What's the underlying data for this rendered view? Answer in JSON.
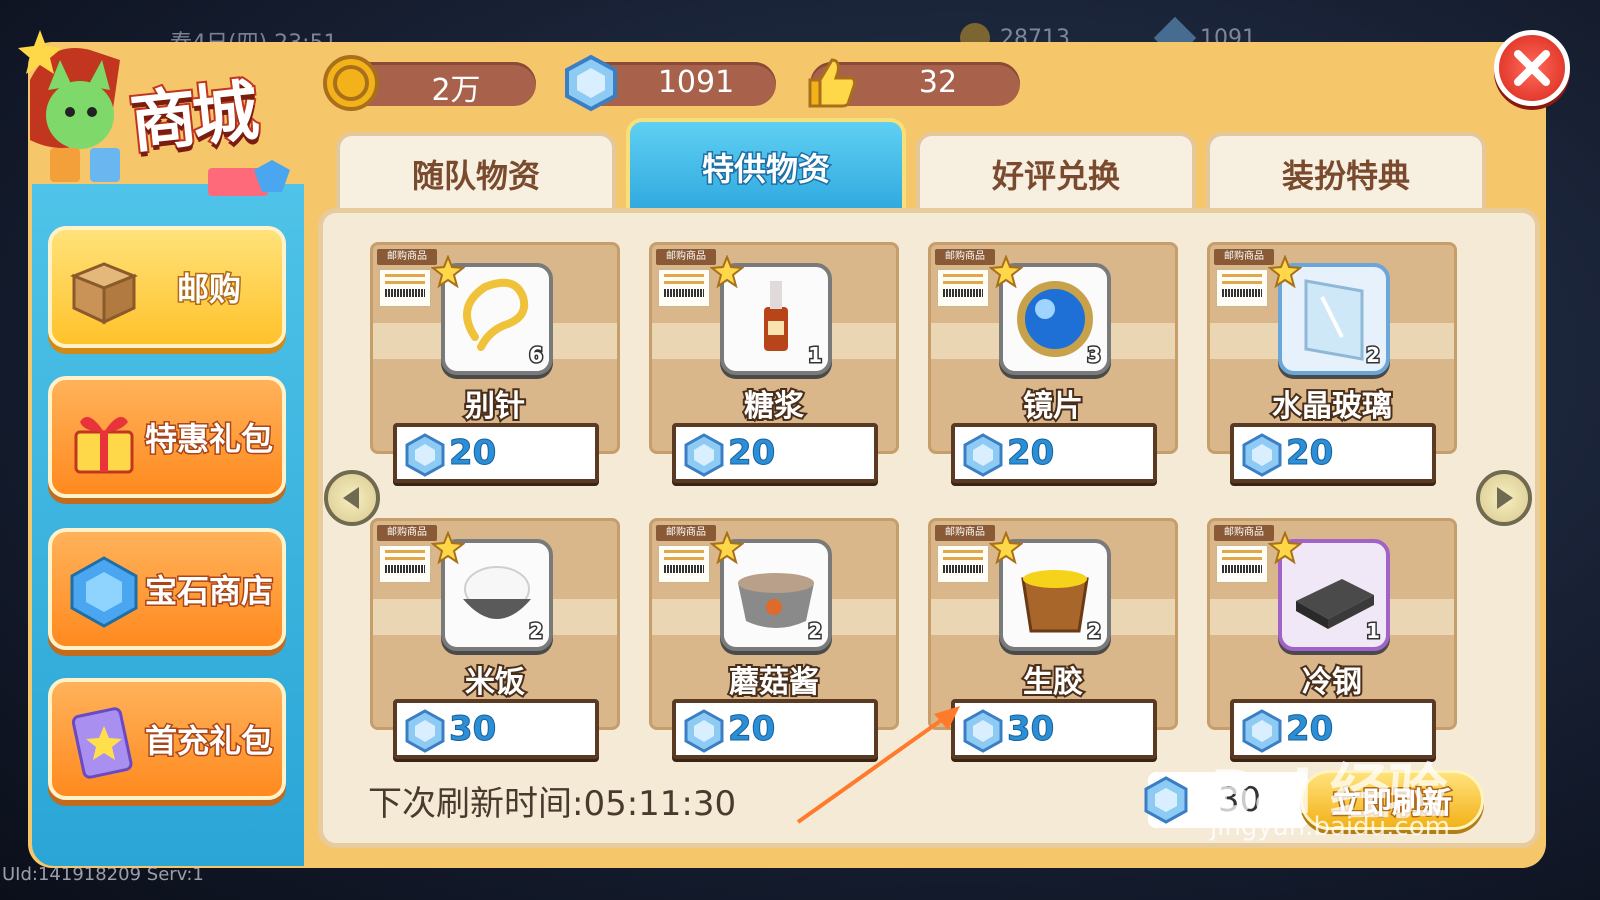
{
  "background": {
    "date_text": "春4日(四) 23:51",
    "coins_text": "28713",
    "gems_text": "1091",
    "uid_text": "UId:141918209 Serv:1"
  },
  "shop": {
    "title": "商城",
    "currencies": [
      {
        "icon": "coin-icon",
        "value": "2万"
      },
      {
        "icon": "gem-icon",
        "value": "1091"
      },
      {
        "icon": "thumbs-up-icon",
        "value": "32"
      }
    ],
    "sidebar": [
      {
        "label": "邮购",
        "icon": "box-icon",
        "active": true
      },
      {
        "label": "特惠礼包",
        "icon": "gift-icon",
        "active": false
      },
      {
        "label": "宝石商店",
        "icon": "gem-icon",
        "active": false
      },
      {
        "label": "首充礼包",
        "icon": "card-icon",
        "active": false
      }
    ],
    "tabs": [
      {
        "label": "随队物资",
        "active": false
      },
      {
        "label": "特供物资",
        "active": true
      },
      {
        "label": "好评兑换",
        "active": false
      },
      {
        "label": "装扮特典",
        "active": false
      }
    ],
    "item_tag": "邮购商品",
    "items": [
      {
        "name": "别针",
        "qty": "6",
        "price": "20",
        "icon": "pin-icon"
      },
      {
        "name": "糖浆",
        "qty": "1",
        "price": "20",
        "icon": "syrup-bottle-icon"
      },
      {
        "name": "镜片",
        "qty": "3",
        "price": "20",
        "icon": "lens-icon"
      },
      {
        "name": "水晶玻璃",
        "qty": "2",
        "price": "20",
        "icon": "crystal-glass-icon"
      },
      {
        "name": "米饭",
        "qty": "2",
        "price": "30",
        "icon": "rice-bowl-icon"
      },
      {
        "name": "蘑菇酱",
        "qty": "2",
        "price": "20",
        "icon": "mushroom-sauce-icon"
      },
      {
        "name": "生胶",
        "qty": "2",
        "price": "30",
        "icon": "raw-rubber-bucket-icon"
      },
      {
        "name": "冷钢",
        "qty": "1",
        "price": "20",
        "icon": "cold-steel-icon"
      }
    ],
    "refresh_time": "下次刷新时间:05:11:30",
    "refresh_cost": "30",
    "refresh_button": "立即刷新"
  },
  "watermark": {
    "main": "Bai 经验",
    "url": "jingyan.baidu.com"
  },
  "colors": {
    "panel": "#f6c66a",
    "sidebar": "#4fc3e8",
    "active_tab": "#2fa8df",
    "price_text": "#2a8fd6",
    "annotation_arrow": "#ff7a2a"
  }
}
